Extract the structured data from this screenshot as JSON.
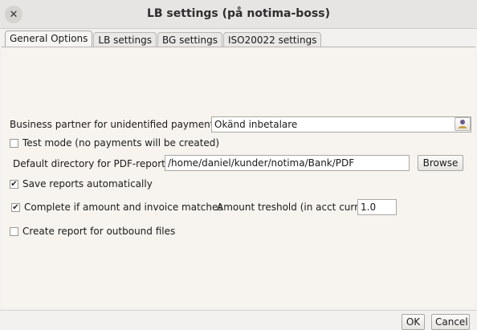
{
  "window": {
    "title": "LB settings (på notima-boss)",
    "close_glyph": "✕"
  },
  "tabs": [
    {
      "label": "General Options",
      "active": true
    },
    {
      "label": "LB settings",
      "active": false
    },
    {
      "label": "BG settings",
      "active": false
    },
    {
      "label": "ISO20022 settings",
      "active": false
    }
  ],
  "form": {
    "partner_label": "Business partner for unidentified payments",
    "partner_value": "Okänd inbetalare",
    "partner_lookup_icon": "person-lookup-icon",
    "test_mode_label": "Test mode (no payments will be created)",
    "test_mode_checked": false,
    "pdf_dir_label": "Default directory for PDF-reports",
    "pdf_dir_value": "/home/daniel/kunder/notima/Bank/PDF",
    "browse_label": "Browse",
    "save_reports_label": "Save reports automatically",
    "save_reports_checked": true,
    "complete_label": "Complete if amount and invoice matches",
    "complete_checked": true,
    "threshold_label": "Amount treshold (in acct curr)",
    "threshold_value": "1.0",
    "outbound_label": "Create report for outbound files",
    "outbound_checked": false
  },
  "footer": {
    "ok_label": "OK",
    "cancel_label": "Cancel"
  },
  "check_glyph": "✔"
}
